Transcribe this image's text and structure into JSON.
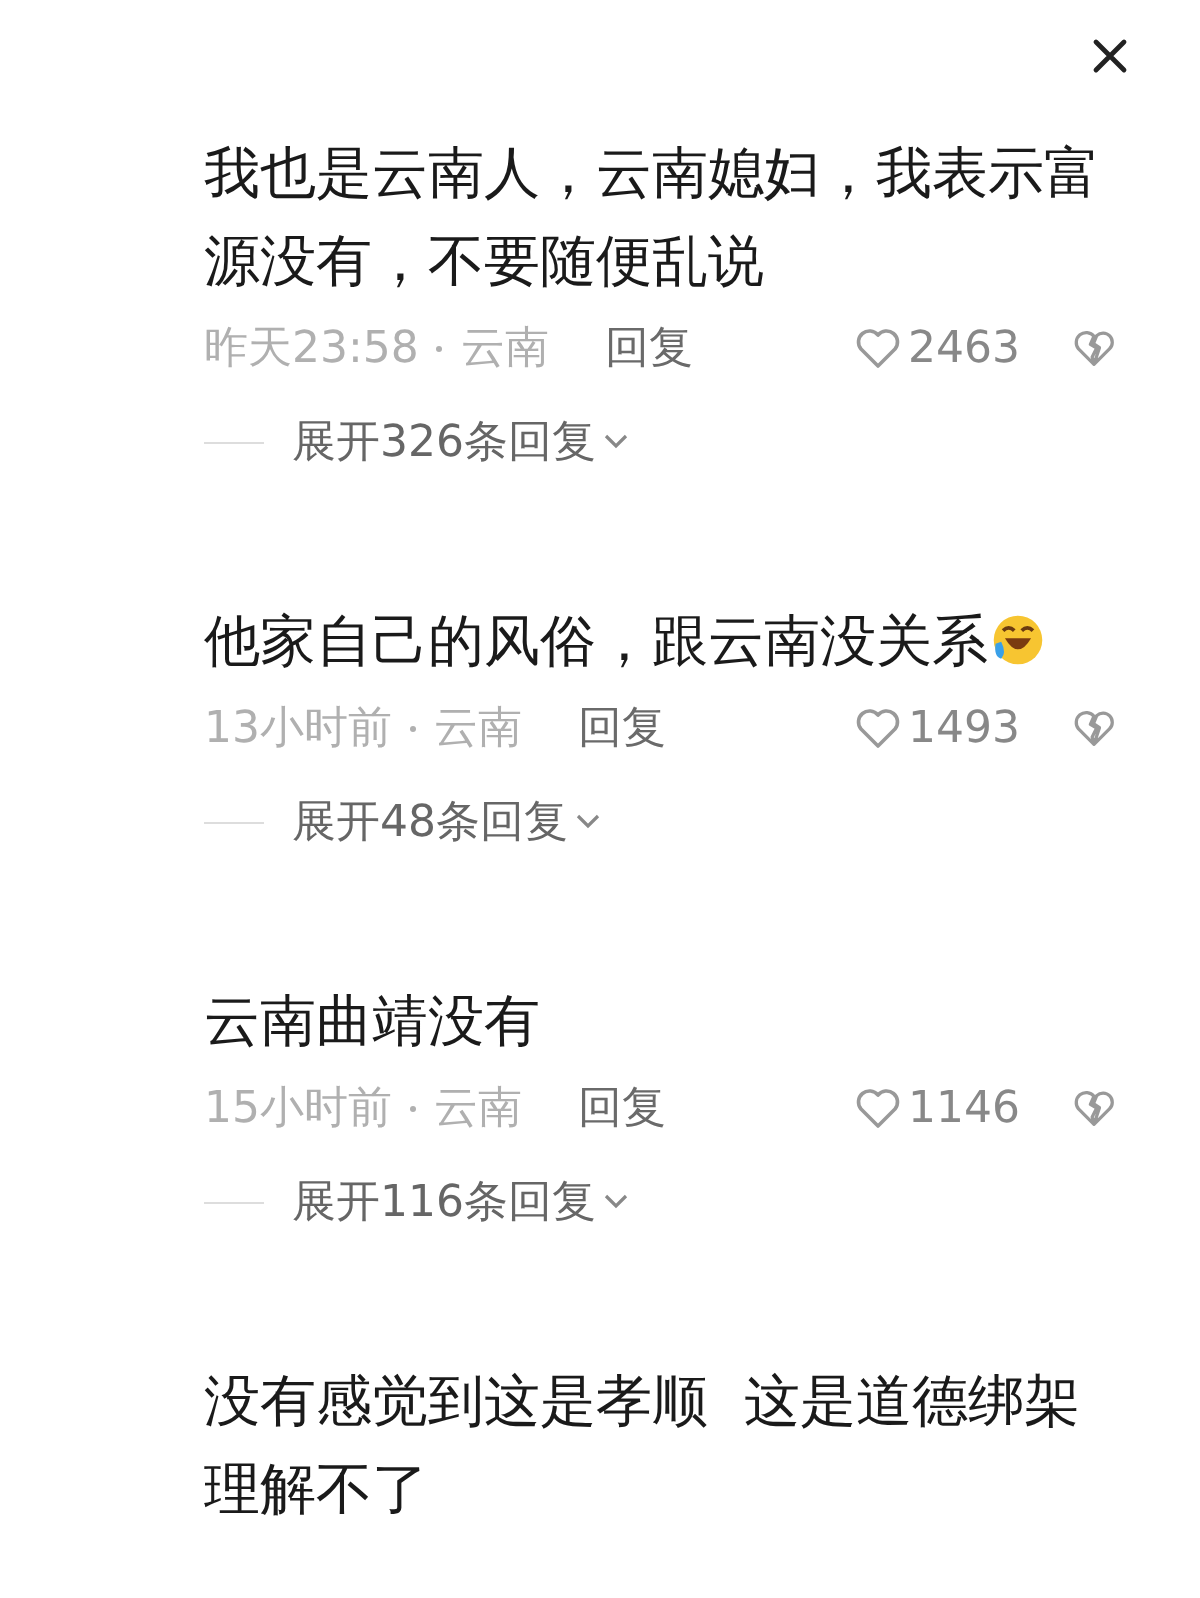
{
  "comments": [
    {
      "text": "我也是云南人，云南媳妇，我表示富源没有，不要随便乱说",
      "time": "昨天23:58",
      "location": "云南",
      "reply": "回复",
      "likes": "2463",
      "expand": "展开326条回复"
    },
    {
      "text": "他家自己的风俗，跟云南没关系",
      "has_emoji": true,
      "time": "13小时前",
      "location": "云南",
      "reply": "回复",
      "likes": "1493",
      "expand": "展开48条回复"
    },
    {
      "text": "云南曲靖没有",
      "time": "15小时前",
      "location": "云南",
      "reply": "回复",
      "likes": "1146",
      "expand": "展开116条回复"
    },
    {
      "text": "没有感觉到这是孝顺  这是道德绑架理解不了"
    }
  ]
}
